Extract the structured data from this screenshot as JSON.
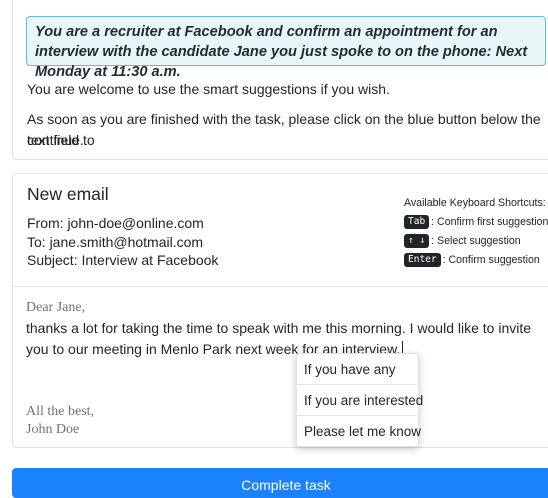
{
  "task": {
    "instruction": "You are a recruiter at Facebook and confirm an appointment for an interview with the candidate Jane you just spoke to on the phone: Next Monday at 11:30 a.m.",
    "line1": "You are welcome to use the smart suggestions if you wish.",
    "line2a": "As soon as you are finished with the task, please click on the blue button below the text field to",
    "line2b": "continue."
  },
  "email": {
    "title": "New email",
    "from": "From: john-doe@online.com",
    "to": "To: jane.smith@hotmail.com",
    "subject": "Subject: Interview at Facebook",
    "greeting": "Dear Jane,",
    "body": "thanks a lot for taking the time to speak with me this morning. I would like to invite you to our meeting in Menlo Park next week for an interview.",
    "closing": "All the best,",
    "signature": "John Doe"
  },
  "shortcuts": {
    "title": "Available Keyboard Shortcuts:",
    "items": [
      {
        "key": "Tab",
        "desc": ": Confirm first suggestion"
      },
      {
        "key": "↑ ↓",
        "desc": ": Select suggestion"
      },
      {
        "key": "Enter",
        "desc": ": Confirm suggestion"
      }
    ]
  },
  "suggestions": [
    "If you have any",
    "If you are interested",
    "Please let me know"
  ],
  "complete_button": "Complete task",
  "colors": {
    "accent": "#1a82fb",
    "task_border": "#5bc0cf",
    "task_bg": "#e9f6f8",
    "kbd_bg": "#212529"
  }
}
